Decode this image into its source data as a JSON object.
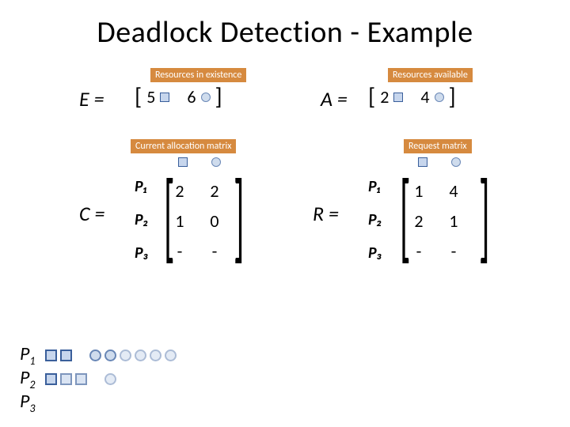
{
  "title": "Deadlock Detection - Example",
  "labels": {
    "E": "E =",
    "A": "A =",
    "C": "C =",
    "R": "R =",
    "P1": "P 1",
    "P2": "P 2",
    "P3": "P 3",
    "res_exist": "Resources in existence",
    "res_avail": "Resources available",
    "cur_alloc": "Current allocation matrix",
    "req_matrix": "Request matrix",
    "Pm1": "P₁",
    "Pm2": "P₂",
    "Pm3": "P₃"
  },
  "vectors": {
    "E": [
      5,
      6
    ],
    "A": [
      2,
      4
    ]
  },
  "matrices": {
    "C": [
      [
        "2",
        "2"
      ],
      [
        "1",
        "0"
      ],
      [
        "-",
        "-"
      ]
    ],
    "R": [
      [
        "1",
        "4"
      ],
      [
        "2",
        "1"
      ],
      [
        "-",
        "-"
      ]
    ]
  },
  "process_alloc": {
    "P1": {
      "squares": 2,
      "circles_strong": 2,
      "circles_weak": 4
    },
    "P2": {
      "squares": 3,
      "circles_strong": 1,
      "circles_weak": 0
    },
    "P3": {
      "squares": 0,
      "circles_strong": 0,
      "circles_weak": 0
    }
  },
  "icons": {
    "blue_square": "resource-type-a-icon",
    "blue_circle": "resource-type-b-icon"
  }
}
